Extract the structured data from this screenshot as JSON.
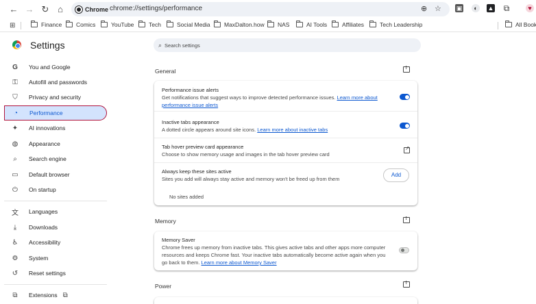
{
  "browser": {
    "chip_label": "Chrome",
    "url": "chrome://settings/performance",
    "icons": [
      "back-icon",
      "forward-icon",
      "reload-icon",
      "home-icon",
      "zoom-icon",
      "star-icon"
    ]
  },
  "bookmarks": [
    "Finance",
    "Comics",
    "YouTube",
    "Tech",
    "Social Media",
    "MaxDalton.how",
    "NAS",
    "AI Tools",
    "Affiliates",
    "Tech Leadership",
    "All Bookr"
  ],
  "sidebar": {
    "title": "Settings",
    "items": [
      {
        "label": "You and Google",
        "icon": "G"
      },
      {
        "label": "Autofill and passwords",
        "icon": "⚿"
      },
      {
        "label": "Privacy and security",
        "icon": "⛉"
      },
      {
        "label": "Performance",
        "icon": "◔"
      },
      {
        "label": "AI innovations",
        "icon": "✦"
      },
      {
        "label": "Appearance",
        "icon": "◍"
      },
      {
        "label": "Search engine",
        "icon": "⌕"
      },
      {
        "label": "Default browser",
        "icon": "▭"
      },
      {
        "label": "On startup",
        "icon": "⏻"
      },
      {
        "label": "Languages",
        "icon": "文"
      },
      {
        "label": "Downloads",
        "icon": "⤓"
      },
      {
        "label": "Accessibility",
        "icon": "♿"
      },
      {
        "label": "System",
        "icon": "⚙"
      },
      {
        "label": "Reset settings",
        "icon": "↺"
      },
      {
        "label": "Extensions",
        "icon": "⧉"
      }
    ]
  },
  "search": {
    "placeholder": "Search settings"
  },
  "sections": {
    "general": {
      "title": "General",
      "alerts_title": "Performance issue alerts",
      "alerts_desc": "Get notifications that suggest ways to improve detected performance issues. ",
      "alerts_link": "Learn more about performance issue alerts",
      "inactive_title": "Inactive tabs appearance",
      "inactive_desc": "A dotted circle appears around site icons. ",
      "inactive_link": "Learn more about inactive tabs",
      "hover_title": "Tab hover preview card appearance",
      "hover_desc": "Choose to show memory usage and images in the tab hover preview card",
      "keep_title": "Always keep these sites active",
      "keep_desc": "Sites you add will always stay active and memory won't be freed up from them",
      "add_label": "Add",
      "no_sites": "No sites added"
    },
    "memory": {
      "title": "Memory",
      "saver_title": "Memory Saver",
      "saver_desc": "Chrome frees up memory from inactive tabs. This gives active tabs and other apps more computer resources and keeps Chrome fast. Your inactive tabs automatically become active again when you go back to them. ",
      "saver_link": "Learn more about Memory Saver"
    },
    "power": {
      "title": "Power"
    }
  },
  "colors": {
    "accent": "#0b57d0",
    "active_bg": "#d3e3fd",
    "highlight_border": "#b0123b"
  }
}
